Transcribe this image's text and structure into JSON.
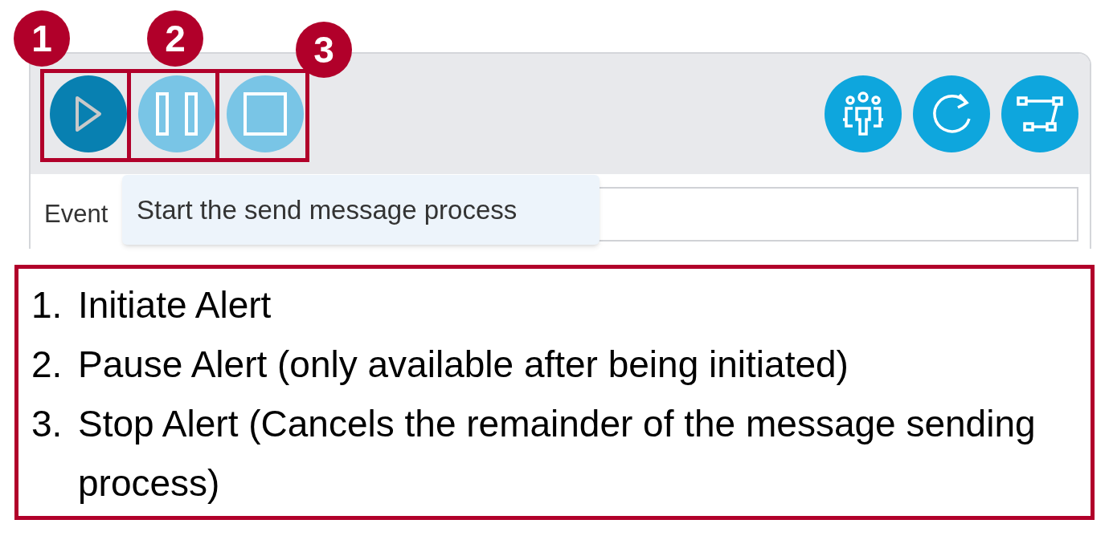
{
  "toolbar": {
    "left_buttons": [
      {
        "kind": "play",
        "disabled": false
      },
      {
        "kind": "pause",
        "disabled": true
      },
      {
        "kind": "stop",
        "disabled": true
      }
    ],
    "right_buttons": [
      {
        "kind": "group"
      },
      {
        "kind": "refresh"
      },
      {
        "kind": "path"
      }
    ]
  },
  "badges": [
    "1",
    "2",
    "3"
  ],
  "form": {
    "label": "Event"
  },
  "tooltip": "Start the send message process",
  "legend": [
    {
      "number": "1.",
      "text": "Initiate Alert"
    },
    {
      "number": "2.",
      "text": "Pause Alert (only available after being initiated)"
    },
    {
      "number": "3.",
      "text": "Stop Alert (Cancels the remainder of the message sending process)"
    }
  ]
}
